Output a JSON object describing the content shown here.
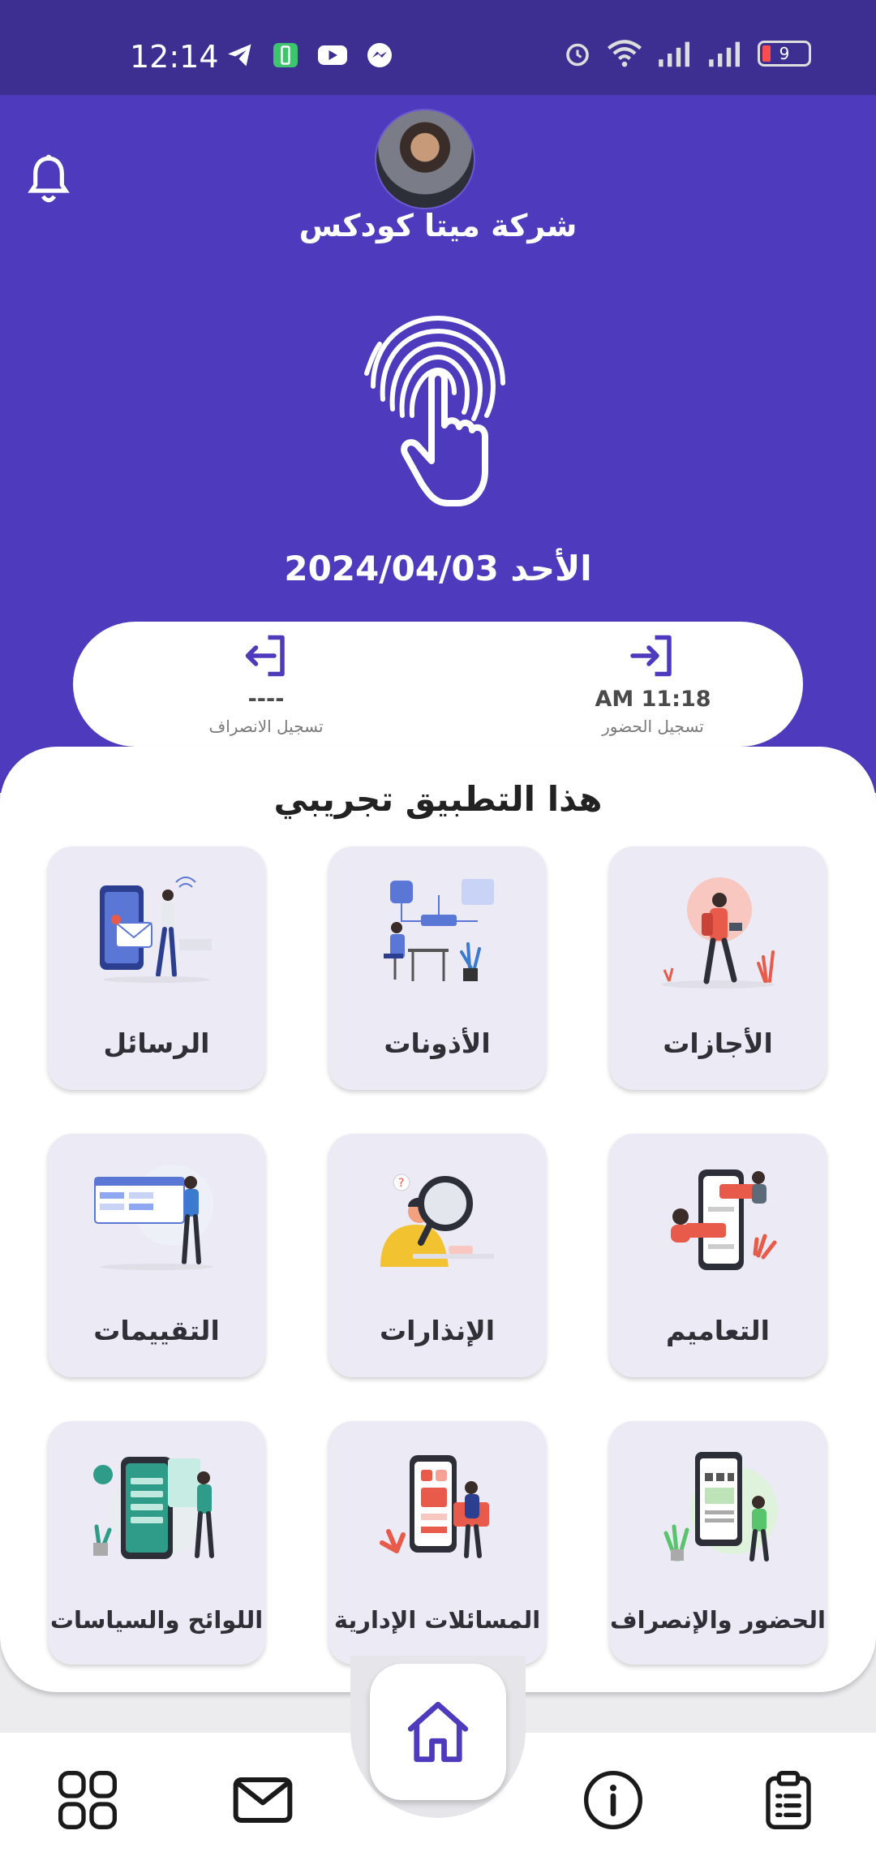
{
  "status_bar": {
    "time": "12:14",
    "battery": "9"
  },
  "header": {
    "company_name": "شركة ميتا كودكس",
    "date": "الأحد 2024/04/03"
  },
  "attendance": {
    "check_in_time": "AM 11:18",
    "check_in_label": "تسجيل الحضور",
    "check_out_time": "----",
    "check_out_label": "تسجيل الانصراف"
  },
  "panel": {
    "title": "هذا التطبيق تجريبي",
    "tiles": [
      {
        "label": "الأجازات",
        "icon": "vacation-illustration"
      },
      {
        "label": "الأذونات",
        "icon": "permissions-illustration"
      },
      {
        "label": "الرسائل",
        "icon": "messages-illustration"
      },
      {
        "label": "التعاميم",
        "icon": "circulars-illustration"
      },
      {
        "label": "الإنذارات",
        "icon": "warnings-illustration"
      },
      {
        "label": "التقييمات",
        "icon": "evaluations-illustration"
      },
      {
        "label": "الحضور والإنصراف",
        "icon": "attendance-illustration"
      },
      {
        "label": "المسائلات الإدارية",
        "icon": "admin-inquiries-illustration"
      },
      {
        "label": "اللوائح والسياسات",
        "icon": "policies-illustration"
      }
    ]
  },
  "colors": {
    "header": "#4d3abd",
    "status_bar": "#3c2f91",
    "accent": "#4d3abd",
    "tile_bg": "#ebeaf5"
  },
  "bottom_nav": [
    "grid-icon",
    "mail-icon",
    "home-icon",
    "info-icon",
    "clipboard-icon"
  ]
}
